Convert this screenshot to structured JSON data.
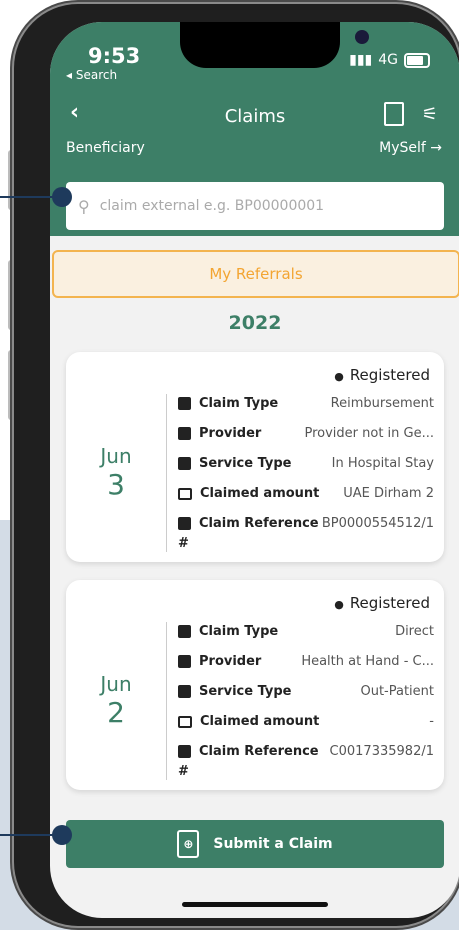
{
  "status_bar": {
    "time": "9:53",
    "back_label": "◂ Search",
    "network": "4G"
  },
  "header": {
    "title": "Claims",
    "beneficiary_label": "Beneficiary",
    "beneficiary_value": "MySelf"
  },
  "search": {
    "placeholder": "claim external e.g. BP00000001"
  },
  "referrals_label": "My Referrals",
  "year": "2022",
  "claims": [
    {
      "month": "Jun",
      "day": "3",
      "status": "Registered",
      "rows": [
        {
          "label": "Claim Type",
          "value": "Reimbursement"
        },
        {
          "label": "Provider",
          "value": "Provider not in Ge..."
        },
        {
          "label": "Service Type",
          "value": "In Hospital Stay"
        },
        {
          "label": "Claimed amount",
          "value": "UAE Dirham 2"
        },
        {
          "label": "Claim Reference",
          "value": "BP0000554512/1"
        }
      ],
      "hash": "#"
    },
    {
      "month": "Jun",
      "day": "2",
      "status": "Registered",
      "rows": [
        {
          "label": "Claim Type",
          "value": "Direct"
        },
        {
          "label": "Provider",
          "value": "Health at Hand - C..."
        },
        {
          "label": "Service Type",
          "value": "Out-Patient"
        },
        {
          "label": "Claimed amount",
          "value": "-"
        },
        {
          "label": "Claim Reference",
          "value": "C0017335982/1"
        }
      ],
      "hash": "#"
    }
  ],
  "submit_label": "Submit a Claim",
  "colors": {
    "primary": "#3d7f67",
    "accent": "#f3a532",
    "pointer": "#1e3a5c"
  }
}
